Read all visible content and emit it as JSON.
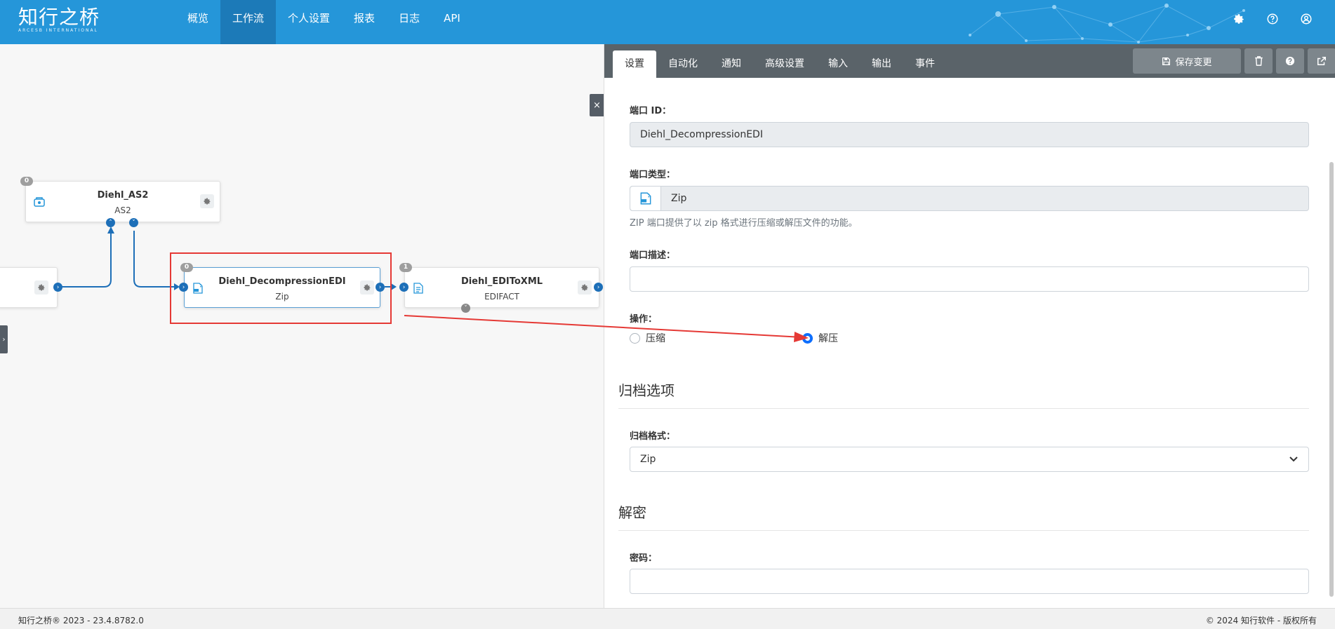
{
  "brand": {
    "name_cn": "知行之桥",
    "name_en": "ARCESB INTERNATIONAL"
  },
  "nav": {
    "items": [
      {
        "label": "概览",
        "active": false
      },
      {
        "label": "工作流",
        "active": true
      },
      {
        "label": "个人设置",
        "active": false
      },
      {
        "label": "报表",
        "active": false
      },
      {
        "label": "日志",
        "active": false
      },
      {
        "label": "API",
        "active": false
      }
    ],
    "icons": [
      "gear-icon",
      "help-icon",
      "user-icon"
    ]
  },
  "canvas": {
    "close_label": "×",
    "nodes": {
      "as2": {
        "title": "Diehl_AS2",
        "subtitle": "AS2",
        "badge": "0"
      },
      "decompress": {
        "title": "Diehl_DecompressionEDI",
        "subtitle": "Zip",
        "badge": "0"
      },
      "edi": {
        "title": "Diehl_EDIToXML",
        "subtitle": "EDIFACT",
        "badge": "1"
      }
    }
  },
  "panel": {
    "tabs": [
      {
        "label": "设置",
        "active": true
      },
      {
        "label": "自动化",
        "active": false
      },
      {
        "label": "通知",
        "active": false
      },
      {
        "label": "高级设置",
        "active": false
      },
      {
        "label": "输入",
        "active": false
      },
      {
        "label": "输出",
        "active": false
      },
      {
        "label": "事件",
        "active": false
      }
    ],
    "save_label": "保存变更",
    "port_id_label": "端口 ID：",
    "port_id_value": "Diehl_DecompressionEDI",
    "port_type_label": "端口类型：",
    "port_type_value": "Zip",
    "port_type_help": "ZIP 端口提供了以 zip 格式进行压缩或解压文件的功能。",
    "port_desc_label": "端口描述：",
    "port_desc_value": "",
    "operation_label": "操作：",
    "op_compress": "压缩",
    "op_decompress": "解压",
    "op_selected": "解压",
    "archive_section": "归档选项",
    "archive_format_label": "归档格式：",
    "archive_format_value": "Zip",
    "decrypt_section": "解密",
    "password_label": "密码：",
    "password_value": ""
  },
  "footer": {
    "left": "知行之桥® 2023 - 23.4.8782.0",
    "right": "© 2024 知行软件 - 版权所有"
  },
  "colors": {
    "nav_bg": "#2596d9",
    "nav_active": "#1c7ab8",
    "tabbar_bg": "#5a6369",
    "port_blue": "#1d6fb8",
    "highlight_red": "#e53935",
    "radio_blue": "#0d6efd"
  }
}
